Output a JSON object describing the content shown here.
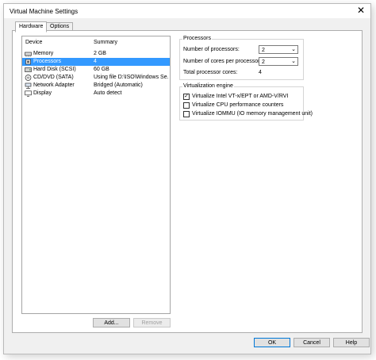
{
  "window": {
    "title": "Virtual Machine Settings"
  },
  "tabs": [
    {
      "label": "Hardware",
      "active": true
    },
    {
      "label": "Options",
      "active": false
    }
  ],
  "device_list": {
    "header_device": "Device",
    "header_summary": "Summary",
    "rows": [
      {
        "name": "Memory",
        "summary": "2 GB",
        "icon": "memory-icon",
        "selected": false
      },
      {
        "name": "Processors",
        "summary": "4",
        "icon": "processor-icon",
        "selected": true
      },
      {
        "name": "Hard Disk (SCSI)",
        "summary": "60 GB",
        "icon": "hard-disk-icon",
        "selected": false
      },
      {
        "name": "CD/DVD (SATA)",
        "summary": "Using file D:\\ISO\\Windows Se...",
        "icon": "cd-dvd-icon",
        "selected": false
      },
      {
        "name": "Network Adapter",
        "summary": "Bridged (Automatic)",
        "icon": "network-adapter-icon",
        "selected": false
      },
      {
        "name": "Display",
        "summary": "Auto detect",
        "icon": "display-icon",
        "selected": false
      }
    ]
  },
  "buttons": {
    "add": "Add...",
    "remove": "Remove",
    "ok": "OK",
    "cancel": "Cancel",
    "help": "Help"
  },
  "processors": {
    "group_title": "Processors",
    "num_processors_label": "Number of processors:",
    "num_processors_value": "2",
    "cores_label": "Number of cores per processor:",
    "cores_value": "2",
    "total_label": "Total processor cores:",
    "total_value": "4"
  },
  "virtualization": {
    "group_title": "Virtualization engine",
    "options": [
      {
        "label": "Virtualize Intel VT-x/EPT or AMD-V/RVI",
        "checked": true
      },
      {
        "label": "Virtualize CPU performance counters",
        "checked": false
      },
      {
        "label": "Virtualize IOMMU (IO memory management unit)",
        "checked": false
      }
    ]
  }
}
